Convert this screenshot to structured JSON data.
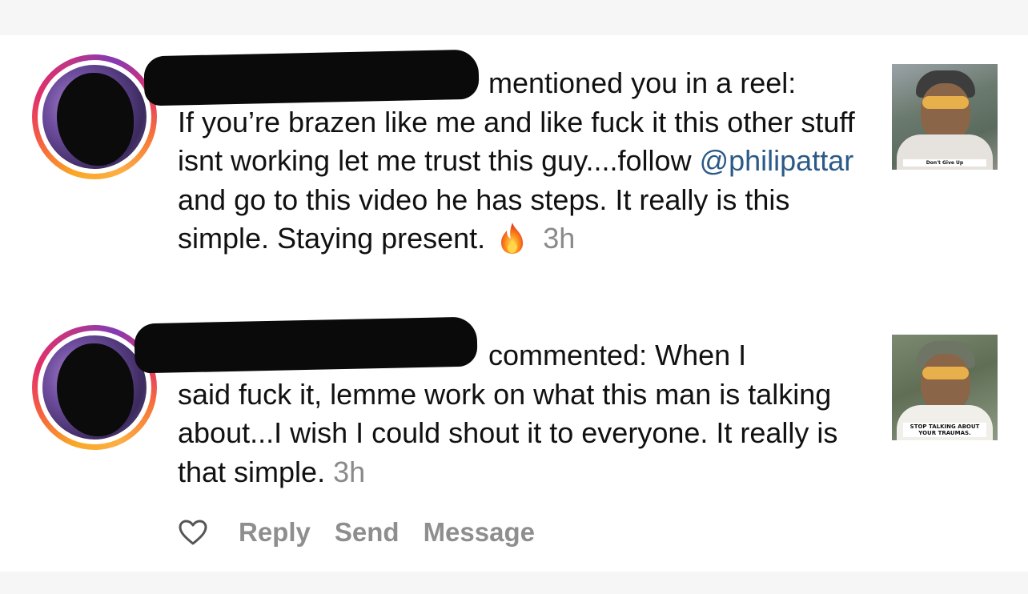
{
  "notifications": [
    {
      "type": "mention",
      "action_text": "mentioned you in a reel:",
      "message_before": "If you’re brazen like me and like fuck it this other stuff isnt working let me trust this guy....follow ",
      "mention": "@philipattar",
      "message_after": " and go to this video he has steps. It really is this simple. Staying present.",
      "emoji": "fire-emoji",
      "time": "3h",
      "thumbnail_caption": "Don't Give Up"
    },
    {
      "type": "comment",
      "action_text": "commented: When I",
      "message": "said fuck it, lemme work on what this man is talking about...I wish I could shout it to everyone. It really is that simple.",
      "time": "3h",
      "thumbnail_caption": "STOP TALKING ABOUT YOUR TRAUMAS."
    }
  ],
  "actions": {
    "like_icon": "heart-icon",
    "reply": "Reply",
    "send": "Send",
    "message": "Message"
  },
  "colors": {
    "mention": "#2c5a87",
    "timestamp": "#8a8a8a",
    "action": "#8e8e8e",
    "avatar_ring": [
      "#fcaf45",
      "#f56040",
      "#e1306c",
      "#833ab4"
    ]
  }
}
